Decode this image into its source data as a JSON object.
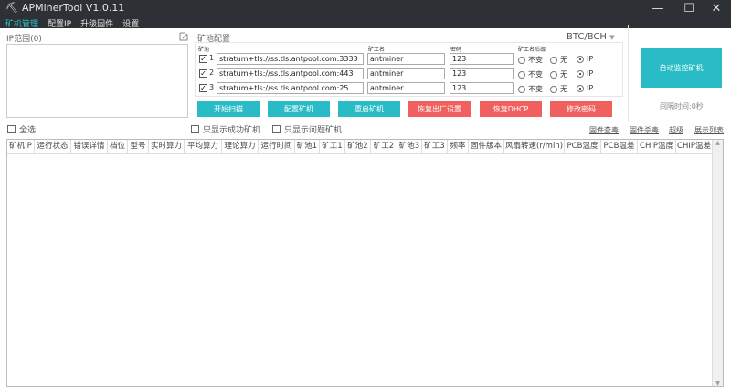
{
  "window": {
    "title": "APMinerTool V1.0.11",
    "logo_icon": "pickaxe-icon"
  },
  "menu": [
    {
      "label": "矿机管理",
      "active": true
    },
    {
      "label": "配置IP"
    },
    {
      "label": "升级固件"
    },
    {
      "label": "设置"
    }
  ],
  "ip_range": {
    "label": "IP范围(0)",
    "value": ""
  },
  "pool_config": {
    "title": "矿池配置",
    "coin": "BTC/BCH",
    "col_pool": "矿池",
    "col_worker": "矿工名",
    "col_password": "密码",
    "col_suffix": "矿工名后缀",
    "rows": [
      {
        "index": "1",
        "checked": true,
        "pool": "stratum+tls://ss.tls.antpool.com:3333",
        "worker": "antminer",
        "password": "123",
        "suffix": "IP"
      },
      {
        "index": "2",
        "checked": true,
        "pool": "stratum+tls://ss.tls.antpool.com:443",
        "worker": "antminer",
        "password": "123",
        "suffix": "IP"
      },
      {
        "index": "3",
        "checked": true,
        "pool": "stratum+tls://ss.tls.antpool.com:25",
        "worker": "antminer",
        "password": "123",
        "suffix": "IP"
      }
    ],
    "suffix_options": [
      "不变",
      "无",
      "IP"
    ]
  },
  "buttons": {
    "scan": "开始扫描",
    "config": "配置矿机",
    "reboot": "重启矿机",
    "factory": "恢复出厂设置",
    "dhcp": "恢复DHCP",
    "password": "修改密码",
    "monitor": "自动监控矿机"
  },
  "colors": {
    "teal": "#29bcc6",
    "red": "#f0605f",
    "titlebar": "#2d3035"
  },
  "interval": "间隔时间:0秒",
  "filters": {
    "select_all": "全选",
    "only_success": "只显示成功矿机",
    "only_problem": "只显示问题矿机"
  },
  "links": [
    "固件查毒",
    "固件杀毒",
    "超级",
    "展示列表"
  ],
  "table": {
    "headers": [
      "矿机IP",
      "运行状态",
      "错误详情",
      "档位",
      "型号",
      "实时算力",
      "平均算力",
      "理论算力",
      "运行时间",
      "矿池1",
      "矿工1",
      "矿池2",
      "矿工2",
      "矿池3",
      "矿工3",
      "频率",
      "固件版本",
      "风扇转速(r/min)",
      "PCB温度",
      "PCB温差",
      "CHIP温度",
      "CHIP温差"
    ],
    "rows": []
  }
}
